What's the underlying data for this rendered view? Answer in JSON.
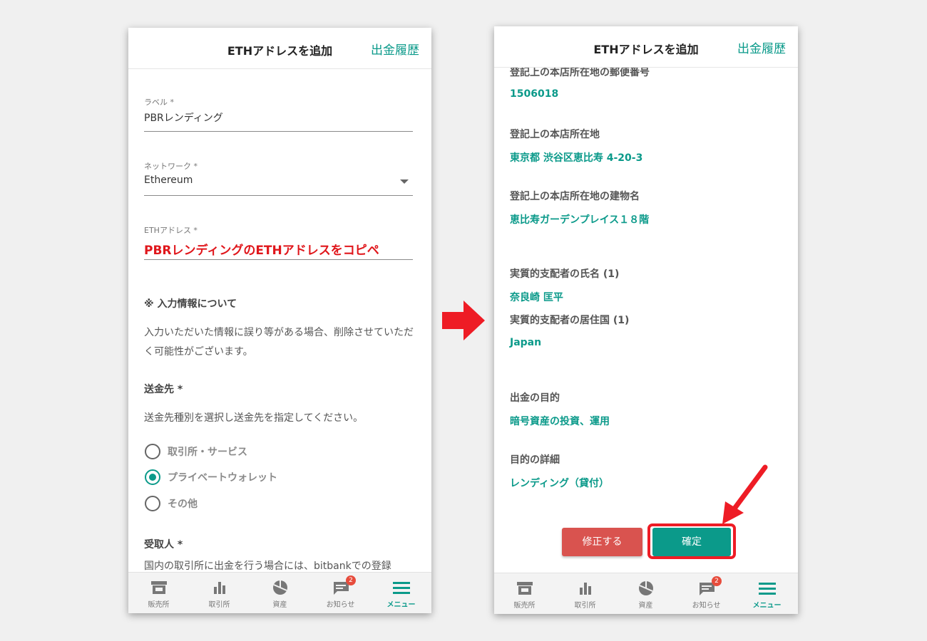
{
  "left": {
    "header": {
      "title": "ETHアドレスを追加",
      "link": "出金履歴"
    },
    "label_field": {
      "label": "ラベル *",
      "value": "PBRレンディング"
    },
    "network_field": {
      "label": "ネットワーク *",
      "value": "Ethereum"
    },
    "address_field": {
      "label": "ETHアドレス *",
      "value": "PBRレンディングのETHアドレスをコピペ"
    },
    "notice": {
      "heading": "※ 入力情報について",
      "text": "入力いただいた情報に誤り等がある場合、削除させていただく可能性がございます。"
    },
    "destination": {
      "heading": "送金先 *",
      "text": "送金先種別を選択し送金先を指定してください。",
      "options": [
        "取引所・サービス",
        "プライベートウォレット",
        "その他"
      ],
      "selected": "プライベートウォレット"
    },
    "recipient": {
      "heading": "受取人 *",
      "text": "国内の取引所に出金を行う場合には、bitbankでの登録"
    }
  },
  "right": {
    "header": {
      "title": "ETHアドレスを追加",
      "link": "出金履歴"
    },
    "fields": [
      {
        "label": "登記上の本店所在地の郵便番号",
        "value": "1506018"
      },
      {
        "label": "登記上の本店所在地",
        "value": "東京都 渋谷区恵比寿 4-20-3"
      },
      {
        "label": "登記上の本店所在地の建物名",
        "value": "恵比寿ガーデンプレイス１８階"
      },
      {
        "label": "実質的支配者の氏名 (1)",
        "value": "奈良崎 匡平"
      },
      {
        "label": "実質的支配者の居住国 (1)",
        "value": "Japan"
      },
      {
        "label": "出金の目的",
        "value": "暗号資産の投資、運用"
      },
      {
        "label": "目的の詳細",
        "value": "レンディング（貸付）"
      }
    ],
    "buttons": {
      "edit": "修正する",
      "confirm": "確定"
    }
  },
  "nav": {
    "items": [
      "販売所",
      "取引所",
      "資産",
      "お知らせ",
      "メニュー"
    ],
    "icons": [
      "shop-icon",
      "bar-chart-icon",
      "pie-chart-icon",
      "chat-icon",
      "hamburger-menu-icon"
    ],
    "active": "メニュー",
    "notification_badge": "2"
  },
  "colors": {
    "accent": "#0b9a8a",
    "annotation_red": "#ee1c25",
    "edit_button": "#d9534f"
  }
}
